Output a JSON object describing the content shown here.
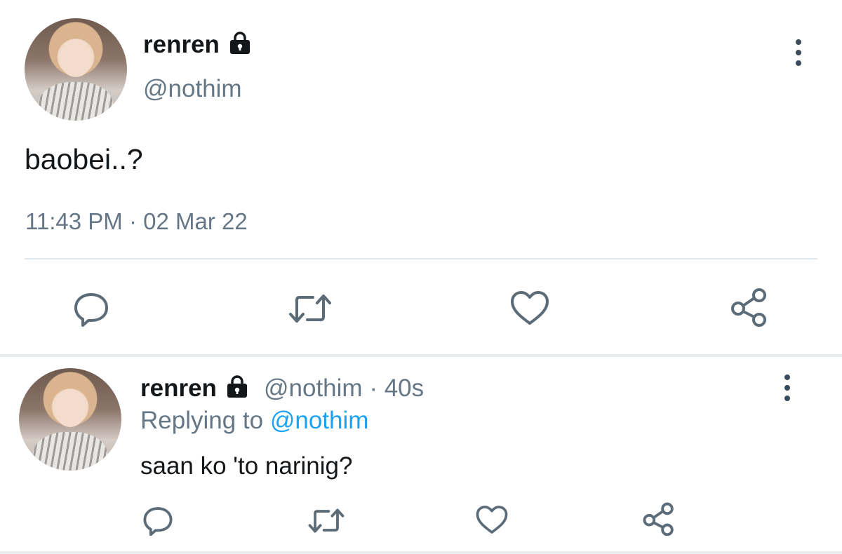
{
  "main_tweet": {
    "display_name": "renren",
    "handle": "@nothim",
    "text": "baobei..?",
    "time": "11:43 PM",
    "date": "02 Mar 22",
    "separator": "·",
    "icons": {
      "lock": "lock-icon",
      "menu": "more-vertical-icon",
      "reply": "reply-icon",
      "retweet": "retweet-icon",
      "like": "heart-icon",
      "share": "share-icon"
    }
  },
  "reply_tweet": {
    "display_name": "renren",
    "handle": "@nothim",
    "separator": "·",
    "age": "40s",
    "replying_prefix": "Replying to",
    "replying_to": "@nothim",
    "text": "saan ko 'to narinig?"
  },
  "colors": {
    "text": "#14171a",
    "secondary": "#657786",
    "link": "#1da1f2",
    "icon": "#5b6b78",
    "divider": "#e1e8ed"
  }
}
